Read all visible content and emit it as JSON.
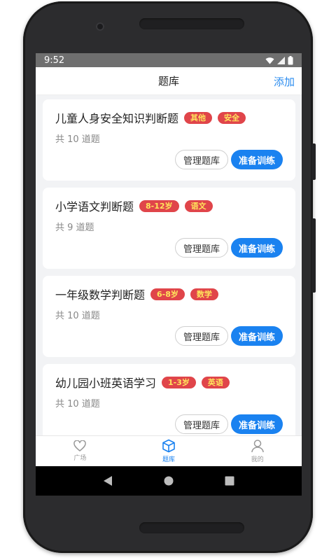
{
  "status_bar": {
    "time": "9:52"
  },
  "header": {
    "title": "题库",
    "add_label": "添加"
  },
  "banks": [
    {
      "title": "儿童人身安全知识判断题",
      "tags": [
        "其他",
        "安全"
      ],
      "count": "共 10 道题"
    },
    {
      "title": "小学语文判断题",
      "tags": [
        "8-12岁",
        "语文"
      ],
      "count": "共 9 道题"
    },
    {
      "title": "一年级数学判断题",
      "tags": [
        "6-8岁",
        "数学"
      ],
      "count": "共 10 道题"
    },
    {
      "title": "幼儿园小班英语学习",
      "tags": [
        "1-3岁",
        "英语"
      ],
      "count": "共 10 道题"
    }
  ],
  "buttons": {
    "manage_label": "管理题库",
    "train_label": "准备训练"
  },
  "tabbar": {
    "tabs": [
      {
        "label": "广场",
        "icon": "heart-icon"
      },
      {
        "label": "题库",
        "icon": "cube-icon",
        "active": true
      },
      {
        "label": "我的",
        "icon": "person-icon"
      }
    ]
  },
  "colors": {
    "accent": "#1a82f0",
    "tag_bg": "#e0454a",
    "tag_text": "#ffe45c"
  }
}
